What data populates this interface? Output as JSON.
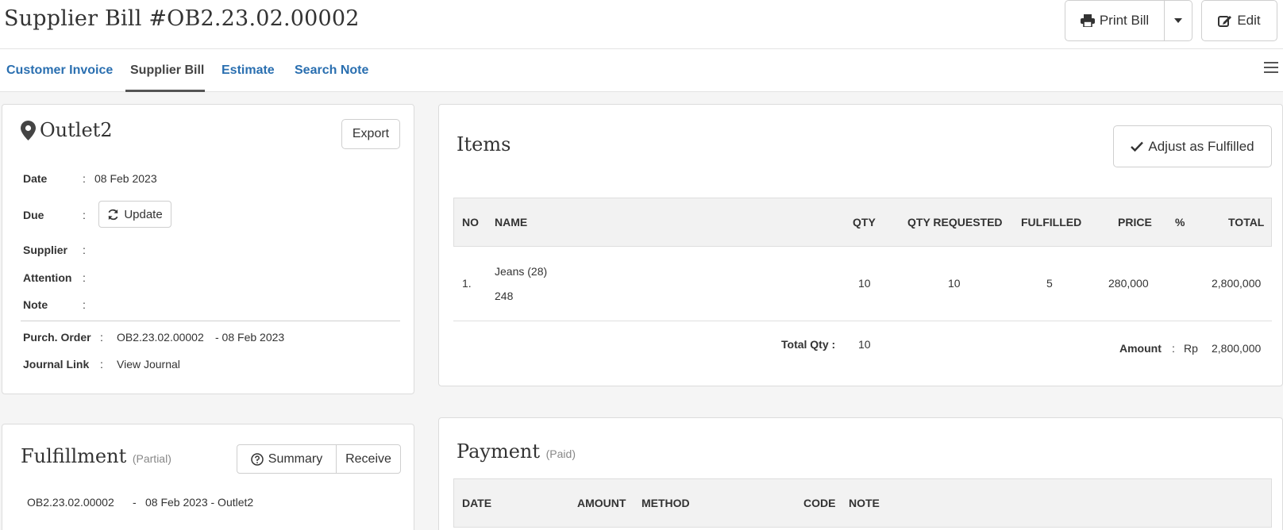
{
  "header": {
    "title": "Supplier Bill #OB2.23.02.00002",
    "print_label": "Print Bill",
    "edit_label": "Edit"
  },
  "tabs": [
    {
      "label": "Customer Invoice",
      "active": false
    },
    {
      "label": "Supplier Bill",
      "active": true
    },
    {
      "label": "Estimate",
      "active": false
    },
    {
      "label": "Search Note",
      "active": false
    }
  ],
  "info": {
    "outlet": "Outlet2",
    "export_label": "Export",
    "date_label": "Date",
    "date_value": "08 Feb 2023",
    "due_label": "Due",
    "update_label": "Update",
    "supplier_label": "Supplier",
    "attention_label": "Attention",
    "note_label": "Note",
    "po_label": "Purch. Order",
    "po_link": "OB2.23.02.00002",
    "po_date": "- 08 Feb 2023",
    "journal_label": "Journal Link",
    "journal_link": "View Journal",
    "colon": ":"
  },
  "items": {
    "title": "Items",
    "adjust_label": "Adjust as Fulfilled",
    "headers": [
      "NO",
      "NAME",
      "QTY",
      "QTY REQUESTED",
      "FULFILLED",
      "PRICE",
      "%",
      "TOTAL"
    ],
    "rows": [
      {
        "no": "1.",
        "name": "Jeans (28)",
        "code": "248",
        "qty": "10",
        "qty_requested": "10",
        "fulfilled": "5",
        "price": "280,000",
        "percent": "",
        "total": "2,800,000"
      }
    ],
    "total_qty_label": "Total Qty :",
    "total_qty": "10",
    "amount_label": "Amount",
    "amount_colon": ":",
    "currency": "Rp",
    "amount": "2,800,000"
  },
  "fulfillment": {
    "title": "Fulfillment",
    "status": "(Partial)",
    "summary_label": "Summary",
    "receive_label": "Receive",
    "entry_link": "OB2.23.02.00002",
    "entry_sep": "-",
    "entry_text": "08 Feb 2023 - Outlet2"
  },
  "payment": {
    "title": "Payment",
    "status": "(Paid)",
    "headers": [
      "DATE",
      "AMOUNT",
      "METHOD",
      "CODE",
      "NOTE"
    ]
  }
}
